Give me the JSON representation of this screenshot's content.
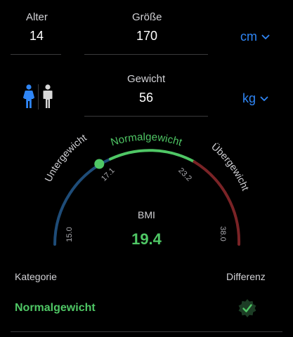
{
  "inputs": {
    "age": {
      "label": "Alter",
      "value": "14"
    },
    "height": {
      "label": "Größe",
      "value": "170",
      "unit": "cm"
    },
    "weight": {
      "label": "Gewicht",
      "value": "56",
      "unit": "kg"
    }
  },
  "gender": {
    "options": [
      "female",
      "male"
    ],
    "selected": "female"
  },
  "gauge": {
    "segments": [
      {
        "name": "Untergewicht",
        "color": "#1e4c78"
      },
      {
        "name": "Normalgewicht",
        "color": "#4fc765"
      },
      {
        "name": "Übergewicht",
        "color": "#7a2326"
      }
    ],
    "ticks": [
      "15.0",
      "17.1",
      "23.2",
      "38.0"
    ],
    "marker_fraction": 0.33
  },
  "result": {
    "bmi_label": "BMI",
    "bmi_value": "19.4"
  },
  "footer": {
    "category_label": "Kategorie",
    "difference_label": "Differenz",
    "category_value": "Normalgewicht"
  },
  "colors": {
    "accent_blue": "#2f86f6",
    "normal_green": "#4fc765",
    "female_active": "#2f86f6",
    "male_inactive": "#d8d8d8"
  }
}
